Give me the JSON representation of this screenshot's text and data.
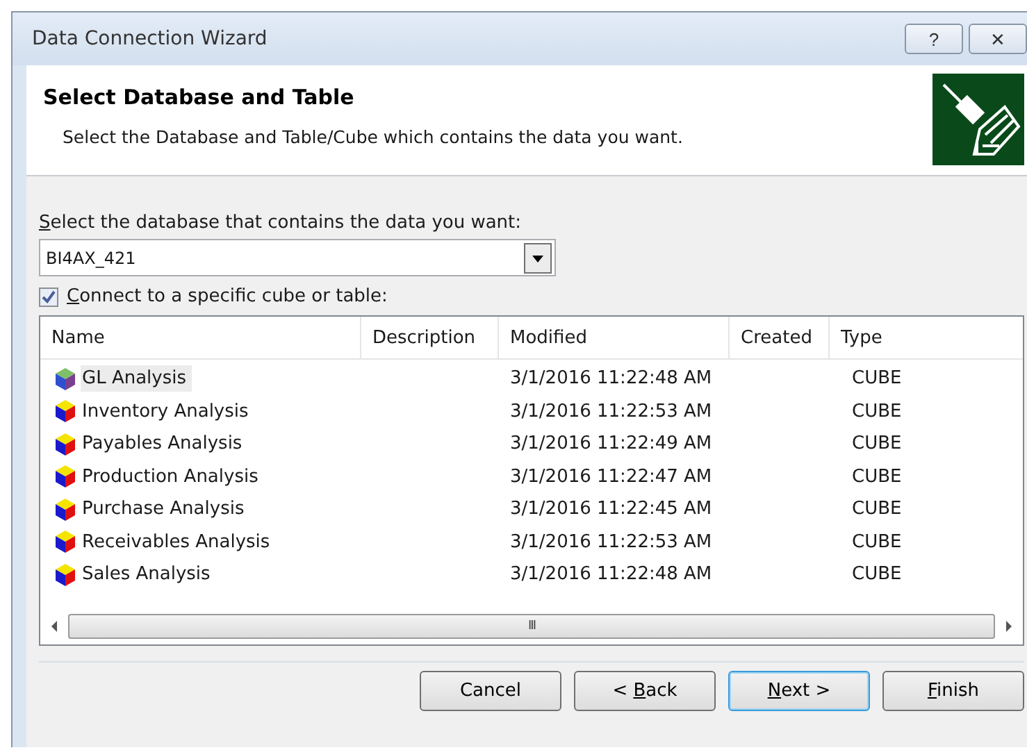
{
  "window": {
    "title": "Data Connection Wizard",
    "controls": [
      "?",
      "✕"
    ]
  },
  "header": {
    "title": "Select Database and Table",
    "subtitle": "Select the Database and Table/Cube which contains the data you want."
  },
  "database": {
    "label": {
      "key": "S",
      "text": "elect the database that contains the data you want:"
    },
    "value": "BI4AX_421"
  },
  "specific": {
    "label": {
      "key": "C",
      "text": "onnect to a specific cube or table:"
    },
    "checked": true
  },
  "table": {
    "columns": [
      "Name",
      "Description",
      "Modified",
      "Created",
      "Type"
    ],
    "rows": [
      {
        "kind": "alt",
        "selected": true,
        "name": "GL Analysis",
        "modified": "3/1/2016 11:22:48 AM",
        "type": "CUBE"
      },
      {
        "kind": "standard",
        "selected": false,
        "name": "Inventory Analysis",
        "modified": "3/1/2016 11:22:53 AM",
        "type": "CUBE"
      },
      {
        "kind": "standard",
        "selected": false,
        "name": "Payables Analysis",
        "modified": "3/1/2016 11:22:49 AM",
        "type": "CUBE"
      },
      {
        "kind": "standard",
        "selected": false,
        "name": "Production Analysis",
        "modified": "3/1/2016 11:22:47 AM",
        "type": "CUBE"
      },
      {
        "kind": "standard",
        "selected": false,
        "name": "Purchase Analysis",
        "modified": "3/1/2016 11:22:45 AM",
        "type": "CUBE"
      },
      {
        "kind": "standard",
        "selected": false,
        "name": "Receivables Analysis",
        "modified": "3/1/2016 11:22:53 AM",
        "type": "CUBE"
      },
      {
        "kind": "standard",
        "selected": false,
        "name": "Sales Analysis",
        "modified": "3/1/2016 11:22:48 AM",
        "type": "CUBE"
      }
    ],
    "scroll_grip": "III"
  },
  "buttons": [
    {
      "text": "Cancel",
      "focused": false
    },
    {
      "pre": "< ",
      "key": "B",
      "text": "ack",
      "focused": false
    },
    {
      "key": "N",
      "text": "ext >",
      "focused": true
    },
    {
      "key": "F",
      "text": "inish",
      "focused": false
    }
  ]
}
